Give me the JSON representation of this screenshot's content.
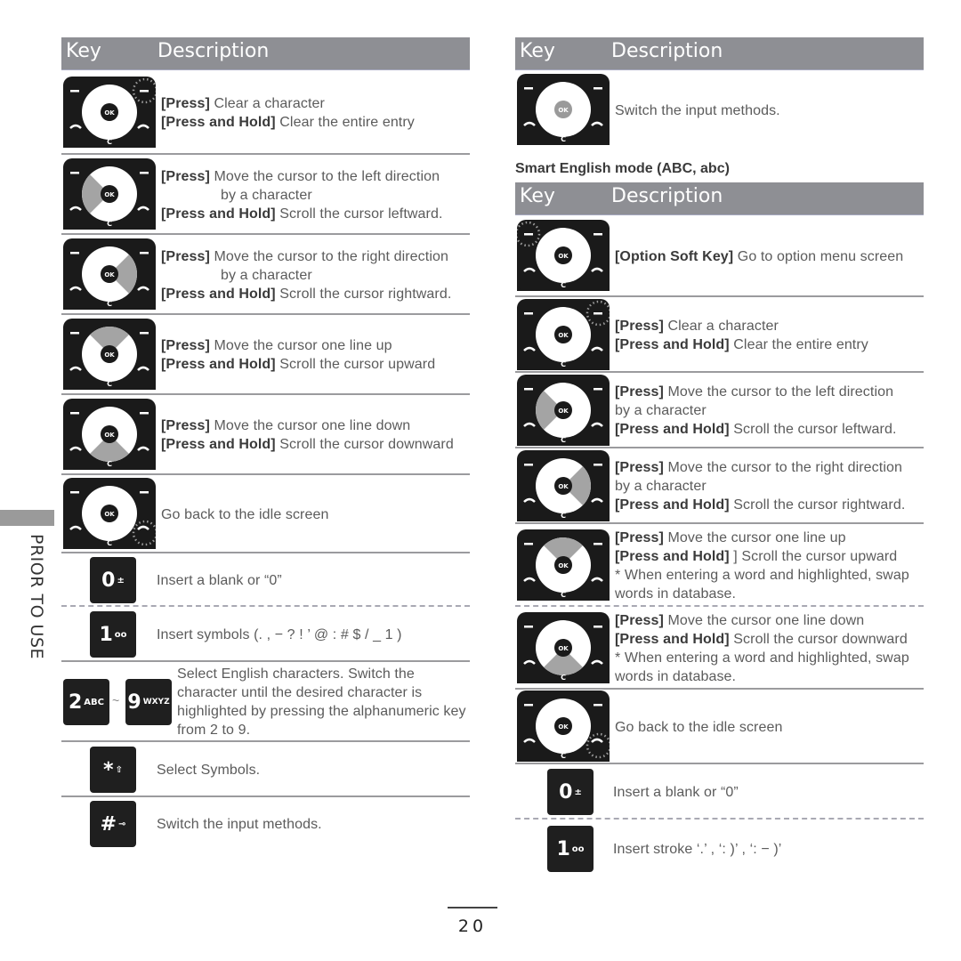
{
  "side_label": "PRIOR TO USE",
  "page_number": "20",
  "left_table": {
    "header": {
      "key": "Key",
      "description": "Description"
    },
    "rows": [
      {
        "icon": "nav-clear-key-icon",
        "lines": [
          {
            "bold": "[Press]",
            "text": " Clear a character"
          },
          {
            "bold": "[Press and Hold]",
            "text": " Clear the entire entry"
          }
        ]
      },
      {
        "icon": "nav-left-icon",
        "lines": [
          {
            "bold": "[Press]",
            "text": " Move the cursor to the left direction"
          },
          {
            "bold": "",
            "text": "by a character"
          },
          {
            "bold": "[Press and Hold]",
            "text": " Scroll the cursor leftward."
          }
        ]
      },
      {
        "icon": "nav-right-icon",
        "lines": [
          {
            "bold": "[Press]",
            "text": " Move the cursor to the right direction"
          },
          {
            "bold": "",
            "text": "by a character"
          },
          {
            "bold": "[Press and Hold]",
            "text": " Scroll the cursor rightward."
          }
        ]
      },
      {
        "icon": "nav-up-icon",
        "lines": [
          {
            "bold": "[Press]",
            "text": " Move the cursor one line up"
          },
          {
            "bold": "[Press and Hold]",
            "text": " Scroll the cursor upward"
          }
        ]
      },
      {
        "icon": "nav-down-icon",
        "lines": [
          {
            "bold": "[Press]",
            "text": " Move the cursor one line down"
          },
          {
            "bold": "[Press and Hold]",
            "text": " Scroll the cursor downward"
          }
        ]
      },
      {
        "icon": "nav-end-key-icon",
        "text": "Go back to the idle screen"
      },
      {
        "key": {
          "n": "0",
          "s": "±"
        },
        "text": "Insert a blank or “0”"
      },
      {
        "key": {
          "n": "1",
          "s": "oo"
        },
        "text": "Insert symbols (. , − ? ! ’ @ :  #  $  /  _ 1 )"
      },
      {
        "keys": [
          {
            "n": "2",
            "s": "ABC"
          },
          {
            "n": "9",
            "s": "WXYZ"
          }
        ],
        "tilde": "~",
        "text": "Select English characters. Switch the character until the desired character is highlighted by pressing the alphanumeric key from 2 to 9."
      },
      {
        "key": {
          "n": "*",
          "s": "⇧"
        },
        "text": "Select Symbols."
      },
      {
        "key": {
          "n": "#",
          "s": "⊸"
        },
        "text": "Switch the input methods."
      }
    ]
  },
  "right_table_top": {
    "header": {
      "key": "Key",
      "description": "Description"
    },
    "rows": [
      {
        "icon": "nav-ok-key-icon",
        "text": "Switch the input methods."
      }
    ]
  },
  "smart_section_title": "Smart English mode (ABC, abc)",
  "right_table": {
    "header": {
      "key": "Key",
      "description": "Description"
    },
    "rows": [
      {
        "icon": "nav-option-soft-key-icon",
        "lines": [
          {
            "bold": "[Option Soft Key]",
            "text": " Go to option menu screen"
          }
        ]
      },
      {
        "icon": "nav-clear-key-icon",
        "lines": [
          {
            "bold": "[Press]",
            "text": " Clear a character"
          },
          {
            "bold": "[Press and Hold]",
            "text": " Clear the entire entry"
          }
        ]
      },
      {
        "icon": "nav-left-icon",
        "lines": [
          {
            "bold": "[Press]",
            "text": " Move the cursor to the left direction"
          },
          {
            "bold": "",
            "text": "by a character"
          },
          {
            "bold": "[Press and Hold]",
            "text": " Scroll the cursor leftward."
          }
        ]
      },
      {
        "icon": "nav-right-icon",
        "lines": [
          {
            "bold": "[Press]",
            "text": " Move the cursor to the right direction"
          },
          {
            "bold": "",
            "text": "by a character"
          },
          {
            "bold": "[Press and Hold]",
            "text": " Scroll the cursor rightward."
          }
        ]
      },
      {
        "icon": "nav-up-icon",
        "lines": [
          {
            "bold": "[Press]",
            "text": " Move the cursor one line up"
          },
          {
            "bold": "[Press and Hold]",
            "text": " ] Scroll the cursor upward"
          },
          {
            "bold": "",
            "text": "* When entering a word and highlighted, swap"
          },
          {
            "bold": "",
            "text": "words in database."
          }
        ]
      },
      {
        "icon": "nav-down-icon",
        "lines": [
          {
            "bold": "[Press]",
            "text": " Move the cursor one line down"
          },
          {
            "bold": "[Press and Hold]",
            "text": " Scroll the cursor downward"
          },
          {
            "bold": "",
            "text": "* When entering a word and highlighted, swap"
          },
          {
            "bold": "",
            "text": "words in database."
          }
        ]
      },
      {
        "icon": "nav-end-key-icon",
        "text": "Go back to the idle screen"
      },
      {
        "key": {
          "n": "0",
          "s": "±"
        },
        "text": "Insert a blank or “0”"
      },
      {
        "key": {
          "n": "1",
          "s": "oo"
        },
        "text": "Insert stroke  ‘.’ ,  ‘: )’ ,  ‘: − )’"
      }
    ]
  }
}
